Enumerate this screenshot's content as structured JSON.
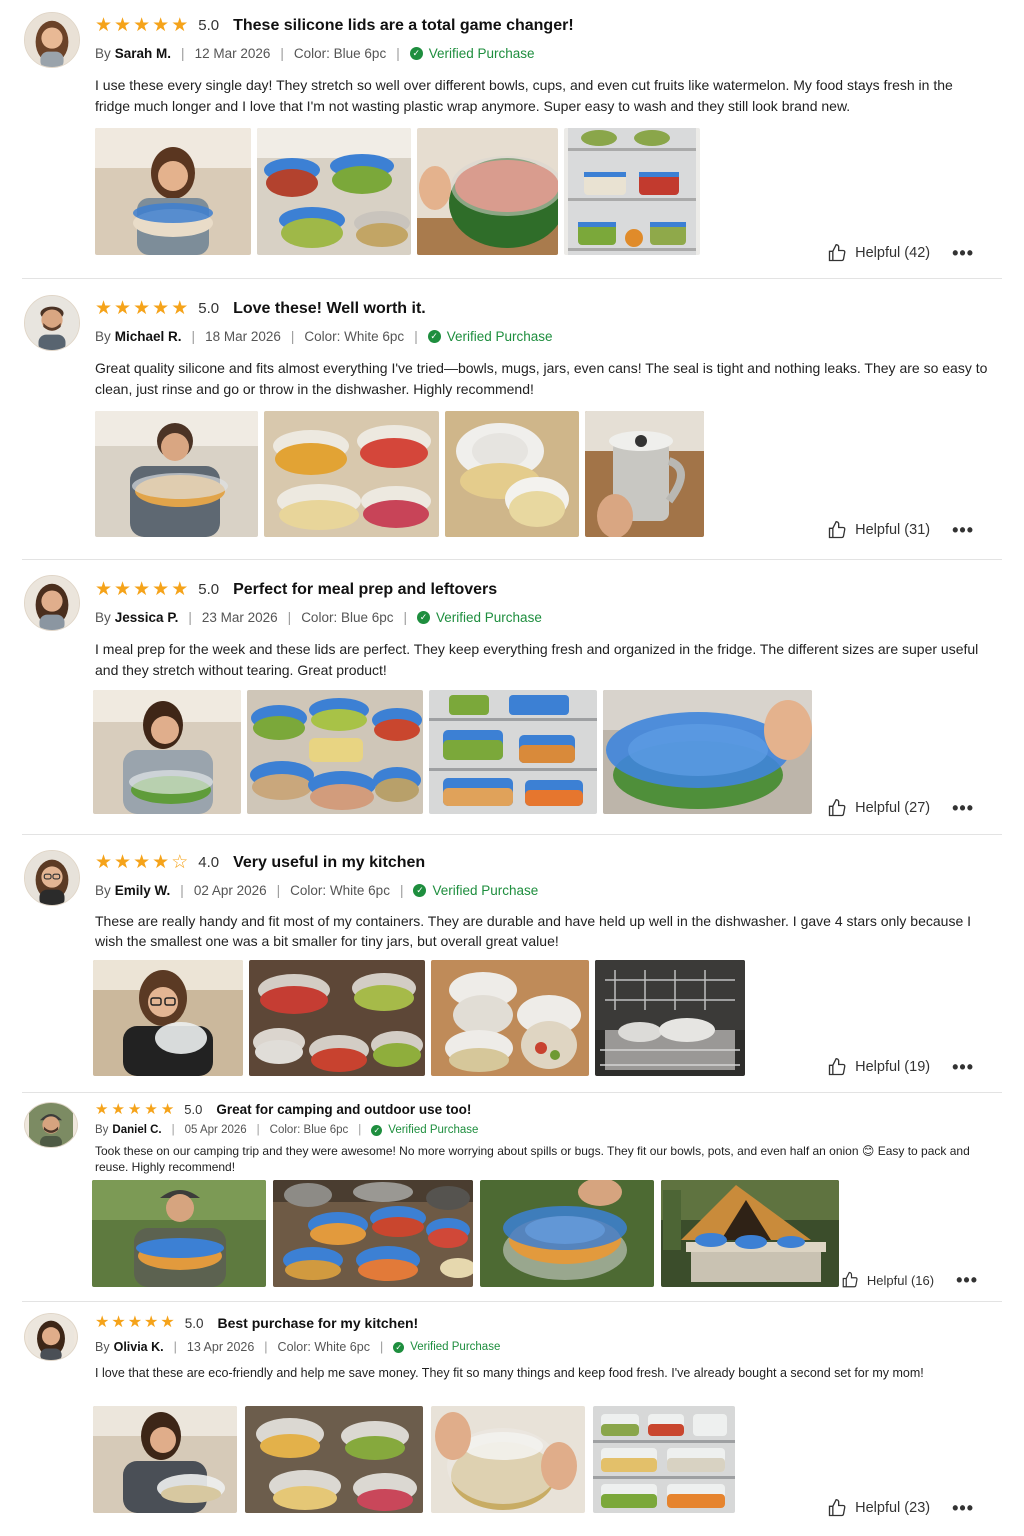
{
  "colors": {
    "star": "#f5a31a",
    "verified": "#1e8e3e",
    "divider": "#e3e3e3"
  },
  "labels": {
    "by": "By",
    "verified": "Verified Purchase",
    "helpful_prefix": "Helpful",
    "more_icon": "more-options-icon"
  },
  "reviews": [
    {
      "stars": 5,
      "rating": "5.0",
      "title": "These silicone lids are a total game changer!",
      "author": "Sarah M.",
      "date": "12 Mar 2026",
      "color": "Color: Blue 6pc",
      "verified": "Verified Purchase",
      "text": "I use these every single day! They stretch so well over different bowls, cups, and even cut fruits like watermelon. My food stays fresh in the fridge much longer and I love that I'm not wasting plastic wrap anymore. Super easy to wash and they still look brand new.",
      "helpful": "Helpful (42)",
      "photos": [
        "woman-holding-bowl",
        "bowls-with-blue-lids",
        "watermelon-covered",
        "fridge-shelves"
      ]
    },
    {
      "stars": 5,
      "rating": "5.0",
      "title": "Love these! Well worth it.",
      "author": "Michael R.",
      "date": "18 Mar 2026",
      "color": "Color: White 6pc",
      "verified": "Verified Purchase",
      "text": "Great quality silicone and fits almost everything I've tried—bowls, mugs, jars, even cans! The seal is tight and nothing leaks. They are so easy to clean, just rinse and go or throw in the dishwasher. Highly recommend!",
      "helpful": "Helpful (31)",
      "photos": [
        "man-holding-bowl",
        "bowls-clear-lids",
        "lid-on-jar",
        "can-with-lid"
      ]
    },
    {
      "stars": 5,
      "rating": "5.0",
      "title": "Perfect for meal prep and leftovers",
      "author": "Jessica P.",
      "date": "23 Mar 2026",
      "color": "Color: Blue 6pc",
      "verified": "Verified Purchase",
      "text": "I meal prep for the week and these lids are perfect. They keep everything fresh and organized in the fridge. The different sizes are super useful and they stretch without tearing. Great product!",
      "helpful": "Helpful (27)",
      "photos": [
        "woman-covering-salad",
        "meal-prep-bowls",
        "fridge-containers",
        "large-bowl-blue-lid"
      ]
    },
    {
      "stars": 4,
      "rating": "4.0",
      "title": "Very useful in my kitchen",
      "author": "Emily W.",
      "date": "02 Apr 2026",
      "color": "Color: White 6pc",
      "verified": "Verified Purchase",
      "text": "These are really handy and fit most of my containers. They are durable and have held up well in the dishwasher. I gave 4 stars only because I wish the smallest one was a bit smaller for tiny jars, but overall great value!",
      "helpful": "Helpful (19)",
      "photos": [
        "woman-with-glasses-lid",
        "bowls-on-table",
        "jars-with-lids",
        "dishwasher-rack"
      ]
    },
    {
      "stars": 5,
      "rating": "5.0",
      "title": "Great for camping and outdoor use too!",
      "author": "Daniel C.",
      "date": "05 Apr 2026",
      "color": "Color: Blue 6pc",
      "verified": "Verified Purchase",
      "text": "Took these on our camping trip and they were awesome! No more worrying about spills or bugs. They fit our bowls, pots, and even half an onion 😊 Easy to pack and reuse. Highly recommend!",
      "helpful": "Helpful (16)",
      "photos": [
        "man-outdoors-bowl",
        "pots-on-camp-table",
        "bowl-blue-lid-closeup",
        "tent-and-table"
      ]
    },
    {
      "stars": 5,
      "rating": "5.0",
      "title": "Best purchase for my kitchen!",
      "author": "Olivia K.",
      "date": "13 Apr 2026",
      "color": "Color: White 6pc",
      "verified": "Verified Purchase",
      "text": "I love that these are eco-friendly and help me save money. They fit so many things and keep food fresh. I've already bought a second set for my mom!",
      "helpful": "Helpful (23)",
      "photos": [
        "woman-kitchen-bowl",
        "bowls-clear-lids-table",
        "melon-covered",
        "fridge-white-lids"
      ]
    }
  ]
}
